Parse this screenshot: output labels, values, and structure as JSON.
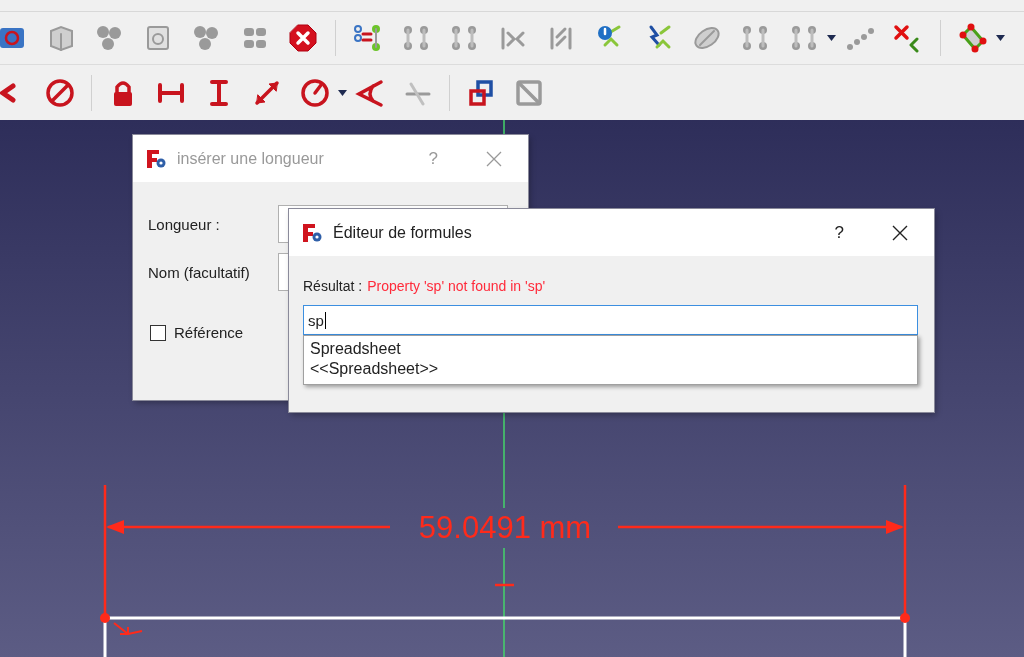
{
  "length_dialog": {
    "title": "insérer une longueur",
    "help": "?",
    "length_label": "Longueur :",
    "name_label": "Nom (facultatif)",
    "reference": {
      "label": "Référence",
      "checked": false
    }
  },
  "formula_editor": {
    "title": "Éditeur de formules",
    "help": "?",
    "result_label": "Résultat :",
    "result_text": "Property 'sp' not found in 'sp'",
    "expression": "sp",
    "completions": [
      {
        "label": "Spreadsheet",
        "selected": false
      },
      {
        "label": "<<Spreadsheet>>",
        "selected": false
      }
    ]
  },
  "sketch": {
    "dimension": "59.0491 mm"
  }
}
